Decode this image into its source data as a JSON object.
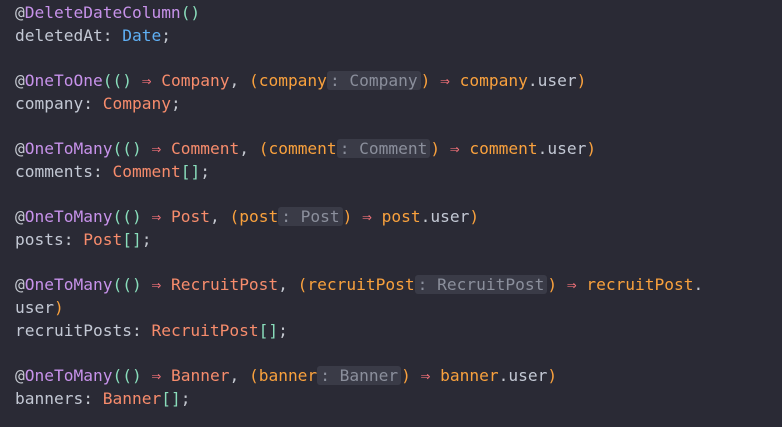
{
  "code": {
    "l1": {
      "at": "@",
      "name": "DeleteDateColumn",
      "parens": "()"
    },
    "l2": {
      "prop": "deletedAt",
      "colon": ": ",
      "type": "Date",
      "semi": ";"
    },
    "l4": {
      "at": "@",
      "name": "OneToOne",
      "open": "(",
      "arrow_parens": "()",
      "arrow1": " ⇒ ",
      "cls": "Company",
      "comma": ", ",
      "popen": "(",
      "param": "company",
      "hint": ": Company",
      "pclose": ")",
      "arrow2": " ⇒ ",
      "ref": "company",
      "dot": ".",
      "field": "user",
      "close": ")"
    },
    "l5": {
      "prop": "company",
      "colon": ": ",
      "type": "Company",
      "semi": ";"
    },
    "l7": {
      "at": "@",
      "name": "OneToMany",
      "open": "(",
      "arrow_parens": "()",
      "arrow1": " ⇒ ",
      "cls": "Comment",
      "comma": ", ",
      "popen": "(",
      "param": "comment",
      "hint": ": Comment",
      "pclose": ")",
      "arrow2": " ⇒ ",
      "ref": "comment",
      "dot": ".",
      "field": "user",
      "close": ")"
    },
    "l8": {
      "prop": "comments",
      "colon": ": ",
      "type": "Comment",
      "brackets": "[]",
      "semi": ";"
    },
    "l10": {
      "at": "@",
      "name": "OneToMany",
      "open": "(",
      "arrow_parens": "()",
      "arrow1": " ⇒ ",
      "cls": "Post",
      "comma": ", ",
      "popen": "(",
      "param": "post",
      "hint": ": Post",
      "pclose": ")",
      "arrow2": " ⇒ ",
      "ref": "post",
      "dot": ".",
      "field": "user",
      "close": ")"
    },
    "l11": {
      "prop": "posts",
      "colon": ": ",
      "type": "Post",
      "brackets": "[]",
      "semi": ";"
    },
    "l13": {
      "at": "@",
      "name": "OneToMany",
      "open": "(",
      "arrow_parens": "()",
      "arrow1": " ⇒ ",
      "cls": "RecruitPost",
      "comma": ", ",
      "popen": "(",
      "param": "recruitPost",
      "hint": ": RecruitPost",
      "pclose": ")",
      "arrow2": " ⇒ ",
      "ref": "recruitPost",
      "dot": "."
    },
    "l14": {
      "field": "user",
      "close": ")"
    },
    "l15": {
      "prop": "recruitPosts",
      "colon": ": ",
      "type": "RecruitPost",
      "brackets": "[]",
      "semi": ";"
    },
    "l17": {
      "at": "@",
      "name": "OneToMany",
      "open": "(",
      "arrow_parens": "()",
      "arrow1": " ⇒ ",
      "cls": "Banner",
      "comma": ", ",
      "popen": "(",
      "param": "banner",
      "hint": ": Banner",
      "pclose": ")",
      "arrow2": " ⇒ ",
      "ref": "banner",
      "dot": ".",
      "field": "user",
      "close": ")"
    },
    "l18": {
      "prop": "banners",
      "colon": ": ",
      "type": "Banner",
      "brackets": "[]",
      "semi": ";"
    }
  },
  "colors": {
    "background": "#2a2a35",
    "decorator": "#c792ea",
    "class": "#f78c6c",
    "parameter": "#f9a13d",
    "arrow": "#f07178",
    "builtin_type": "#5fb0f5",
    "inlay_hint_bg": "#3a3b47"
  }
}
